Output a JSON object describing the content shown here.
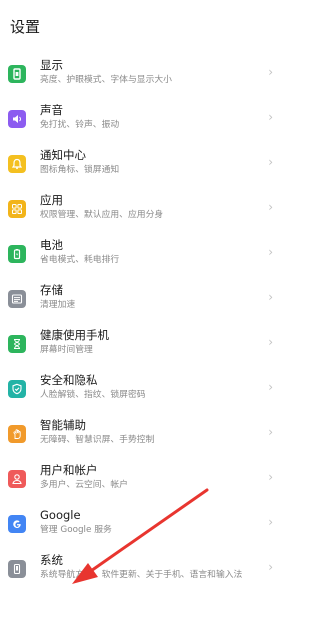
{
  "header": {
    "title": "设置"
  },
  "items": [
    {
      "title": "显示",
      "subtitle": "亮度、护眼模式、字体与显示大小",
      "color": "#2db55d",
      "icon": "display-icon"
    },
    {
      "title": "声音",
      "subtitle": "免打扰、铃声、振动",
      "color": "#8c5cf0",
      "icon": "sound-icon"
    },
    {
      "title": "通知中心",
      "subtitle": "图标角标、锁屏通知",
      "color": "#f4c020",
      "icon": "bell-icon"
    },
    {
      "title": "应用",
      "subtitle": "权限管理、默认应用、应用分身",
      "color": "#f2b41a",
      "icon": "apps-grid-icon"
    },
    {
      "title": "电池",
      "subtitle": "省电模式、耗电排行",
      "color": "#2db55d",
      "icon": "battery-icon"
    },
    {
      "title": "存储",
      "subtitle": "清理加速",
      "color": "#8a8f98",
      "icon": "storage-icon"
    },
    {
      "title": "健康使用手机",
      "subtitle": "屏幕时间管理",
      "color": "#2db55d",
      "icon": "hourglass-icon"
    },
    {
      "title": "安全和隐私",
      "subtitle": "人脸解锁、指纹、锁屏密码",
      "color": "#23b3a6",
      "icon": "shield-icon"
    },
    {
      "title": "智能辅助",
      "subtitle": "无障碍、智慧识屏、手势控制",
      "color": "#f19a2b",
      "icon": "hand-icon"
    },
    {
      "title": "用户和帐户",
      "subtitle": "多用户、云空间、帐户",
      "color": "#ef5a5a",
      "icon": "user-icon"
    },
    {
      "title": "Google",
      "subtitle": "管理 Google 服务",
      "color": "#4285f4",
      "icon": "google-icon"
    },
    {
      "title": "系统",
      "subtitle": "系统导航方式、软件更新、关于手机、语言和输入法",
      "color": "#8a8f98",
      "icon": "system-phone-icon"
    }
  ],
  "chevron": "›",
  "annotation_color": "#e8352f"
}
